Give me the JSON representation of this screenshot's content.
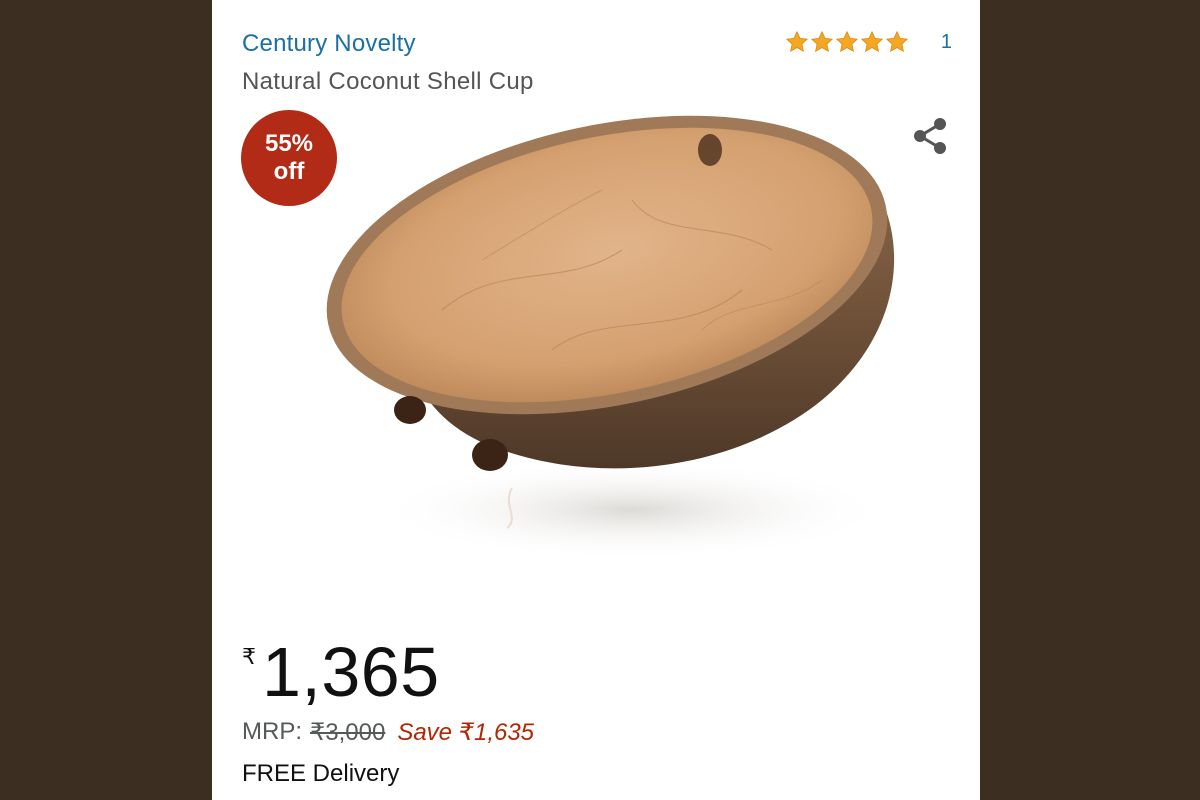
{
  "product": {
    "brand": "Century Novelty",
    "title": "Natural Coconut Shell Cup",
    "rating_stars": 5,
    "rating_count": "1",
    "discount_percent": "55%",
    "discount_label": "off",
    "price_symbol": "₹",
    "price": "1,365",
    "mrp_label": "MRP:",
    "mrp_value": "₹3,000",
    "save_text": "Save ₹1,635",
    "delivery": "FREE Delivery"
  },
  "icons": {
    "share": "share-icon",
    "star": "star-icon"
  },
  "colors": {
    "brand_link": "#1a6fa3",
    "badge": "#b12b16",
    "save": "#b12704",
    "star": "#f5a623",
    "background": "#3d2e22"
  }
}
